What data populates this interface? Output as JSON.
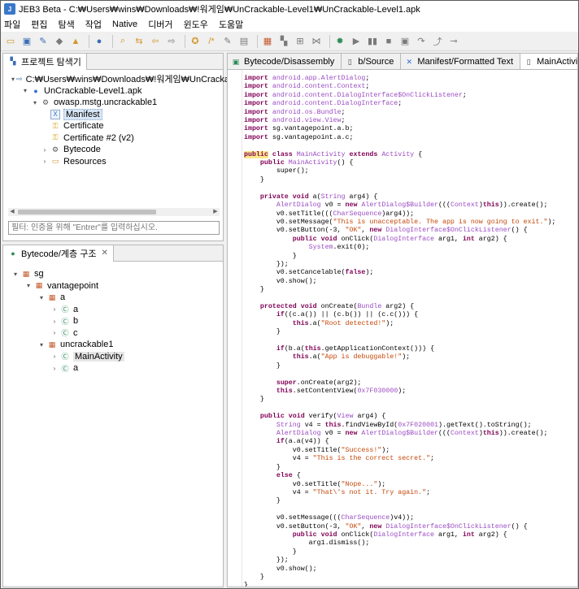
{
  "window": {
    "title": "JEB3 Beta - C:₩Users₩wins₩Downloads₩!워게임₩UnCrackable-Level1₩UnCrackable-Level1.apk"
  },
  "menu": [
    "파일",
    "편집",
    "탐색",
    "작업",
    "Native",
    "디버거",
    "윈도우",
    "도움말"
  ],
  "explorer": {
    "tab": "프로젝트 탐색기",
    "path": "C:₩Users₩wins₩Downloads₩!워게임₩UnCrackable-L",
    "apk": "UnCrackable-Level1.apk",
    "package": "owasp.mstg.uncrackable1",
    "items": [
      "Manifest",
      "Certificate",
      "Certificate #2 (v2)",
      "Bytecode",
      "Resources"
    ],
    "filter_placeholder": "필터: 인증을 위해 \"Entrer\"를 입력하십시오."
  },
  "hierarchy": {
    "tab": "Bytecode/계층 구조",
    "sg": "sg",
    "vantagepoint": "vantagepoint",
    "a": "a",
    "a_a": "a",
    "a_b": "b",
    "a_c": "c",
    "uncrackable1": "uncrackable1",
    "main": "MainActivity",
    "u_a": "a"
  },
  "editor_tabs": [
    "Bytecode/Disassembly",
    "b/Source",
    "Manifest/Formatted Text",
    "MainActivity/"
  ],
  "icons": [
    "open-icon",
    "save-icon",
    "wrench-icon",
    "run-icon",
    "warning-icon",
    "globe-icon",
    "search-icon",
    "back-icon",
    "forward-icon",
    "grid-icon",
    "debug-icon",
    "play-icon"
  ],
  "colors": {
    "keyword": "#7f0055",
    "type": "#9b4cc2",
    "string": "#c4480a"
  }
}
